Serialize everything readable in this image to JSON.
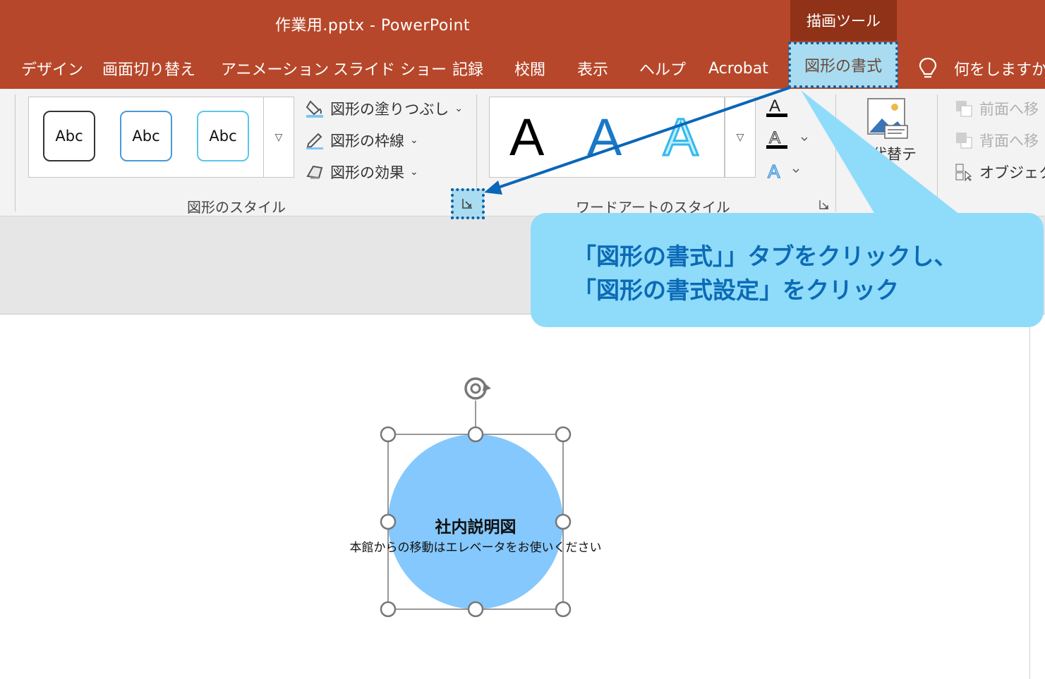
{
  "window": {
    "title": "作業用.pptx  -  PowerPoint",
    "context_tab_group": "描画ツール"
  },
  "tabs": [
    "デザイン",
    "画面切り替え",
    "アニメーション",
    "スライド ショー",
    "記録",
    "校閲",
    "表示",
    "ヘルプ",
    "Acrobat",
    "図形の書式"
  ],
  "tell_me": {
    "label": "何をしますか",
    "icon": "lightbulb-icon"
  },
  "ribbon": {
    "shape_styles": {
      "gallery": [
        "Abc",
        "Abc",
        "Abc"
      ],
      "fill": "図形の塗りつぶし",
      "outline": "図形の枠線",
      "effects": "図形の効果",
      "group_label": "図形のスタイル"
    },
    "wordart": {
      "gallery": [
        "A",
        "A",
        "A"
      ],
      "group_label": "ワードアートのスタイル"
    },
    "accessibility": {
      "alt_text": "代替テ"
    },
    "arrange": {
      "bring_forward": "前面へ移",
      "send_backward": "背面へ移",
      "selection_pane": "オブジェクト"
    }
  },
  "callout": {
    "line1": "「図形の書式」」タブをクリックし、",
    "line2": "「図形の書式設定」をクリック"
  },
  "shape": {
    "title": "社内説明図",
    "subtitle": "本館からの移動はエレベータをお使いください",
    "fill_color": "#85c8fd"
  },
  "colors": {
    "titlebar": "#b7472a",
    "highlight": "#a9dcf0",
    "arrow": "#0a66b8",
    "callout": "#8fdcfa"
  }
}
